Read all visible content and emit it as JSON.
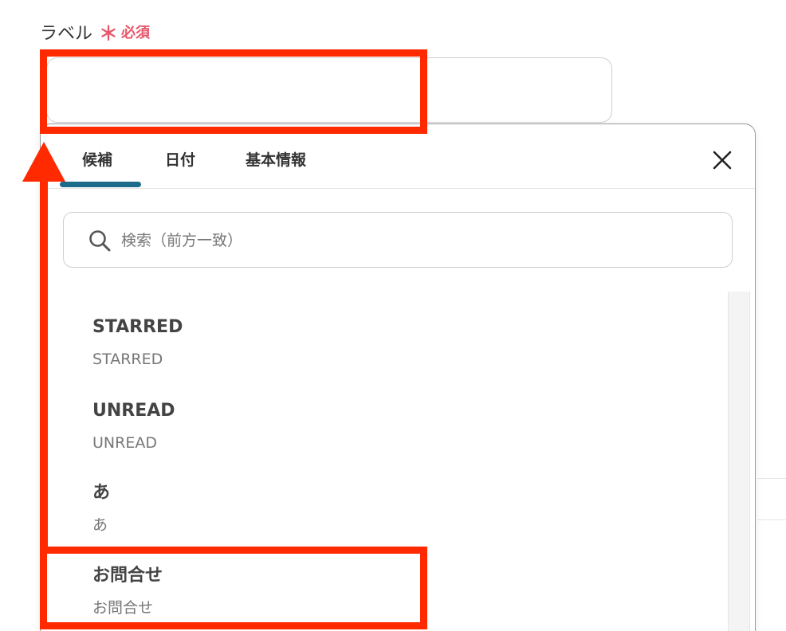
{
  "field": {
    "label": "ラベル",
    "required_star": "＊",
    "required_text": "必須",
    "value": ""
  },
  "tabs": [
    {
      "label": "候補",
      "active": true
    },
    {
      "label": "日付",
      "active": false
    },
    {
      "label": "基本情報",
      "active": false
    }
  ],
  "search": {
    "placeholder": "検索（前方一致）"
  },
  "items": [
    {
      "title": "STARRED",
      "subtitle": "STARRED"
    },
    {
      "title": "UNREAD",
      "subtitle": "UNREAD"
    },
    {
      "title": "あ",
      "subtitle": "あ"
    },
    {
      "title": "お問合せ",
      "subtitle": "お問合せ"
    }
  ],
  "colors": {
    "accent": "#1d6b8a",
    "required": "#e8566a",
    "annotation": "#ff2a00"
  }
}
